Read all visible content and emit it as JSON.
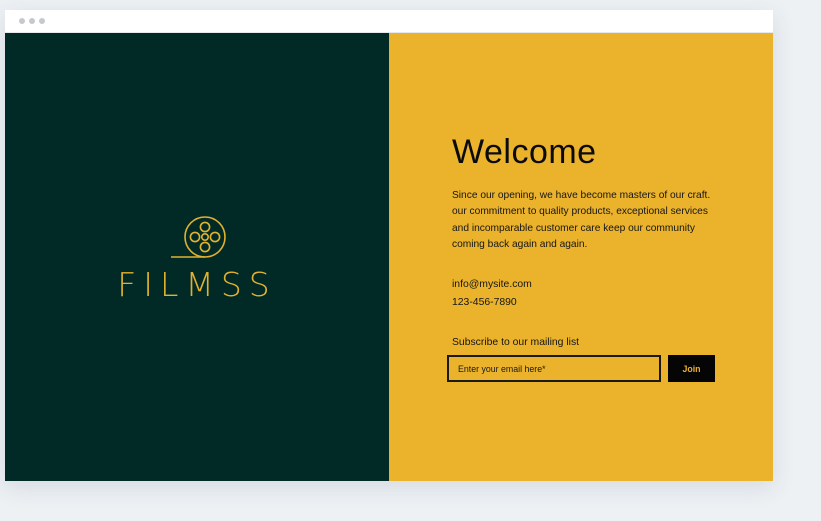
{
  "colors": {
    "left_panel_bg": "#012a27",
    "right_panel_bg": "#ebb22c",
    "logo_gold": "#e3b12e",
    "text_dark": "#111111"
  },
  "titlebar": {
    "controls": [
      "dot-icon",
      "dot-icon",
      "dot-icon"
    ]
  },
  "brand": {
    "name": "FILMSS",
    "logo_icon": "film-reel-icon"
  },
  "content": {
    "heading": "Welcome",
    "about": "Since our opening, we have become masters of our craft. our commitment to quality products, exceptional services and incomparable customer care keep our community coming back again and again.",
    "email": "info@mysite.com",
    "phone": "123-456-7890"
  },
  "subscribe": {
    "label": "Subscribe to our mailing list",
    "placeholder": "Enter your email here*",
    "button_label": "Join"
  }
}
